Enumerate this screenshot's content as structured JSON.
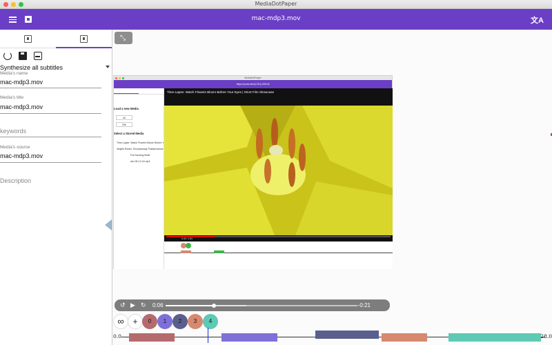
{
  "window": {
    "title": "MediaDotPaper"
  },
  "appbar": {
    "title": "mac-mdp3.mov"
  },
  "colors": {
    "accent": "#6a3fc6",
    "track0": "#b56a6e",
    "track1": "#7e6fd9",
    "track2": "#5b5f8e",
    "track3": "#d6896f",
    "track4": "#5ec9b4"
  },
  "icons": {
    "menu": "menu-icon",
    "save_to_box": "archive-icon",
    "translate": "translate-icon",
    "tab_media": "media-library-icon",
    "tab_text": "document-icon",
    "refresh": "refresh-icon",
    "save": "save-icon",
    "subtitles": "subtitles-icon",
    "expand": "expand-icon"
  },
  "sidebar": {
    "synthesize_label": "Synthesize all subtitles",
    "fields": {
      "name": {
        "label": "Media's name",
        "value": "mac-mdp3.mov"
      },
      "title": {
        "label": "Media's title",
        "value": "mac-mdp3.mov"
      },
      "keywords": {
        "placeholder": "keywords"
      },
      "source": {
        "label": "Media's source",
        "value": "mac-mdp3.mov"
      },
      "description": {
        "placeholder": "Description"
      }
    }
  },
  "embedded": {
    "window_title": "MediaDotPaper",
    "url": "https://youtu.be/LjCdTp-IXELM",
    "load_heading": "Load a new Media",
    "url_button": "url",
    "file_button": "File",
    "stored_heading": "Select a Stored Media",
    "stored_items": [
      "Time-Lapse: Watch Flowers Bloom Before Y",
      "Wojtek Rolain: Потрясающе Романтичные",
      "The Dancing Bride",
      "odo-06-12-16.mp3"
    ],
    "video_title": "Time-Lapse: Watch Flowers Bloom Before Your Eyes | Short Film Showcase",
    "video_time": "0:40 / 1:53"
  },
  "player": {
    "current_time": "0:06",
    "remaining_time": "-0:21",
    "progress": 0.25,
    "buffered": 0.42
  },
  "tracks": [
    {
      "label": "0"
    },
    {
      "label": "1"
    },
    {
      "label": "2"
    },
    {
      "label": "3"
    },
    {
      "label": "4"
    }
  ],
  "timeline": {
    "start": "0.0",
    "end": "28.0",
    "cursor_time": 5.7,
    "segments": [
      {
        "track": 0,
        "start": 0.5,
        "end": 3.5
      },
      {
        "track": 1,
        "start": 6.6,
        "end": 10.3
      },
      {
        "track": 2,
        "start": 12.8,
        "end": 17.0
      },
      {
        "track": 3,
        "start": 17.2,
        "end": 20.2
      },
      {
        "track": 4,
        "start": 21.6,
        "end": 29.0
      }
    ]
  }
}
